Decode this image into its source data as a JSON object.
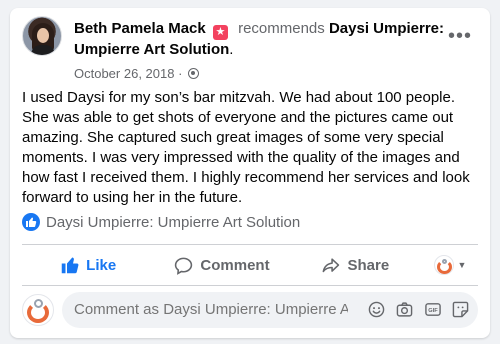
{
  "post": {
    "author": "Beth Pamela Mack",
    "verb": "recommends",
    "page_name": "Daysi Umpierre: Umpierre Art Solution",
    "page_name_line1": "Daysi Umpierre:",
    "page_name_line2": "Umpierre Art Solution",
    "period": ".",
    "date": "October 26, 2018",
    "separator": " · ",
    "body": "I used Daysi for my son’s bar mitzvah. We had about 100 people. She was able to get shots of everyone and the pictures came out amazing. She captured such great images of some very special moments. I was very impressed with the quality of the images and how fast I received them. I highly recommend her services and look forward to using her in the future."
  },
  "reactions": {
    "liker": "Daysi Umpierre: Umpierre Art Solution"
  },
  "actions": {
    "like": "Like",
    "comment": "Comment",
    "share": "Share"
  },
  "comment_box": {
    "placeholder": "Comment as Daysi Umpierre: Umpierre A..."
  },
  "icons": {
    "recommend": "recommend-star-icon",
    "more": "more-options-icon",
    "privacy": "globe-icon",
    "like_reaction": "thumbs-up-icon",
    "comment": "speech-bubble-icon",
    "share": "share-arrow-icon",
    "emoji": "smiley-icon",
    "camera": "camera-icon",
    "gif": "gif-icon",
    "sticker": "sticker-icon"
  },
  "colors": {
    "accent": "#1877f2",
    "recommend_badge": "#f3425f",
    "logo": "#e86a3a"
  }
}
